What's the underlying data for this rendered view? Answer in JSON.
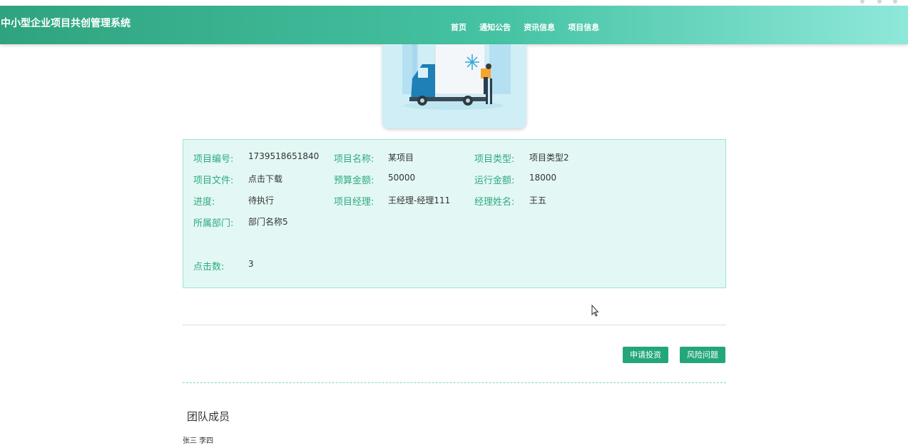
{
  "header": {
    "brand": "中小型企业项目共创管理系统",
    "nav": [
      "首页",
      "通知公告",
      "资讯信息",
      "项目信息"
    ]
  },
  "project": {
    "id_label": "项目编号:",
    "id": "1739518651840",
    "name_label": "项目名称:",
    "name": "某项目",
    "type_label": "项目类型:",
    "type": "项目类型2",
    "file_label": "项目文件:",
    "file": "点击下载",
    "budget_label": "预算金额:",
    "budget": "50000",
    "running_label": "运行金额:",
    "running": "18000",
    "progress_label": "进度:",
    "progress": "待执行",
    "manager_label": "项目经理:",
    "manager": "王经理-经理111",
    "manager_name_label": "经理姓名:",
    "manager_name": "王五",
    "dept_label": "所属部门:",
    "dept": "部门名称5",
    "clicks_label": "点击数:",
    "clicks": "3"
  },
  "actions": {
    "apply_invest": "申请投资",
    "risk_issue": "风险问题"
  },
  "team": {
    "title": "团队成员",
    "members": "张三 李四"
  },
  "colors": {
    "primary": "#23a779",
    "label": "#2ea982",
    "panel_bg": "#e3f8f4",
    "panel_border": "#9ee3d4"
  },
  "icons": [
    "cursor-icon",
    "snowflake-icon"
  ]
}
